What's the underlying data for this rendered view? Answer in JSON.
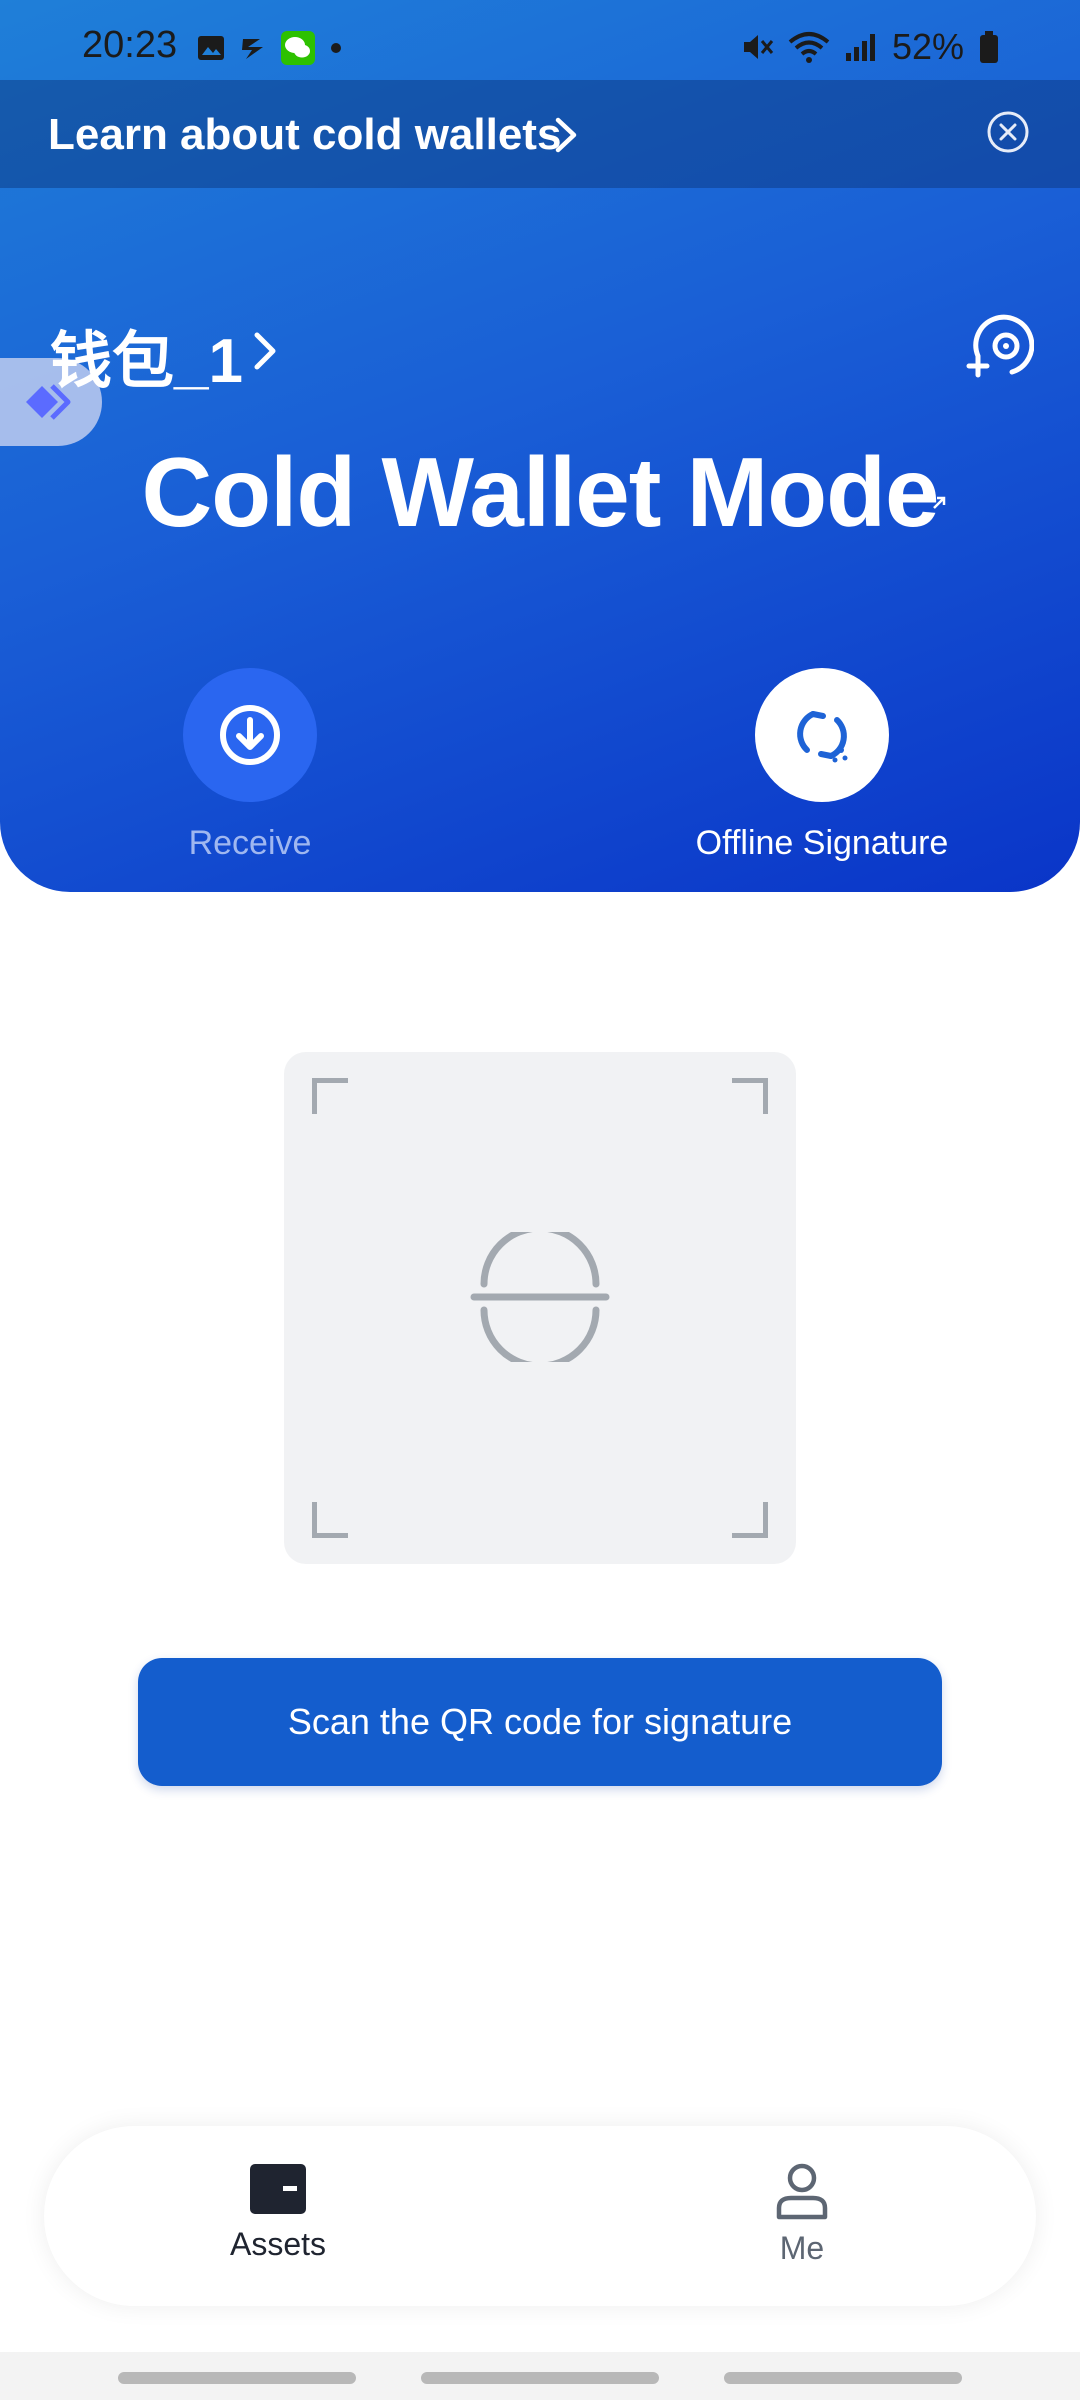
{
  "status_bar": {
    "time": "20:23",
    "battery": "52%"
  },
  "banner": {
    "text": "Learn about cold wallets"
  },
  "wallet": {
    "name": "钱包_1"
  },
  "mode": {
    "title": "Cold Wallet Mode"
  },
  "actions": {
    "receive_label": "Receive",
    "offline_label": "Offline Signature"
  },
  "scan": {
    "button_label": "Scan the QR code for signature"
  },
  "nav": {
    "assets_label": "Assets",
    "me_label": "Me"
  },
  "colors": {
    "primary": "#145dcd",
    "hero_start": "#1f7fd8",
    "hero_end": "#0a35c8"
  }
}
